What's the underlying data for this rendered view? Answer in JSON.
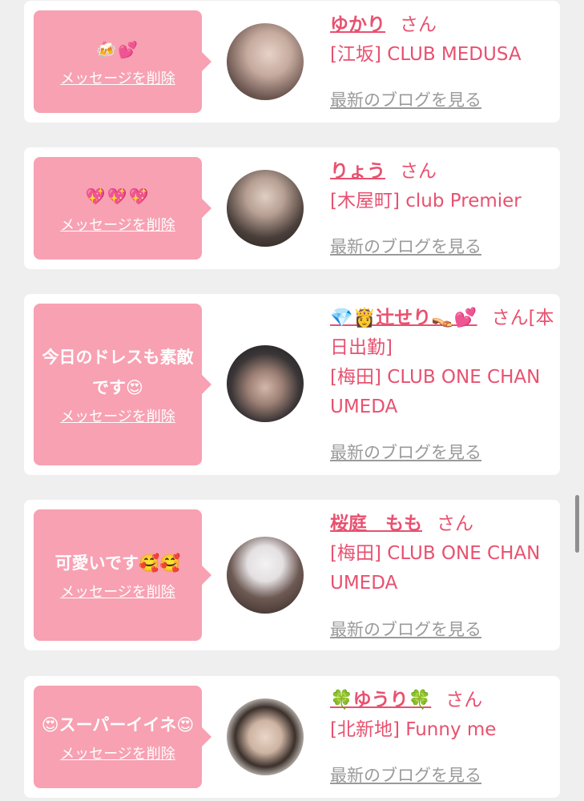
{
  "cards": [
    {
      "message": "🍻💕",
      "message_is_emoji": true,
      "delete_label": "メッセージを削除",
      "name": "ゆかり",
      "honorific": "さん",
      "shop": "[江坂] CLUB MEDUSA",
      "blog_label": "最新のブログを見る",
      "avatar_colors": [
        "#d9c2b8",
        "#5a4742"
      ]
    },
    {
      "message": "💖💖💖",
      "message_is_emoji": true,
      "delete_label": "メッセージを削除",
      "name": "りょう",
      "honorific": "さん",
      "shop": "[木屋町] club Premier",
      "blog_label": "最新のブログを見る",
      "avatar_colors": [
        "#cbb8aa",
        "#2d2724"
      ]
    },
    {
      "message": "今日のドレスも素敵です😍",
      "message_is_emoji": false,
      "delete_label": "メッセージを削除",
      "name": "💎👸辻せり👡💕",
      "honorific": "さん[本日出勤]",
      "shop": "[梅田] CLUB ONE CHAN UMEDA",
      "blog_label": "最新のブログを見る",
      "avatar_colors": [
        "#3a3536",
        "#c7a79b"
      ]
    },
    {
      "message": "可愛いです🥰🥰",
      "message_is_emoji": false,
      "delete_label": "メッセージを削除",
      "name": "桜庭　もも",
      "honorific": "さん",
      "shop": "[梅田] CLUB ONE CHAN UMEDA",
      "blog_label": "最新のブログを見る",
      "avatar_colors": [
        "#e9e6e8",
        "#3f2f2b"
      ]
    },
    {
      "message": "😍スーパーイイネ😍",
      "message_is_emoji": false,
      "delete_label": "メッセージを削除",
      "name": "🍀ゆうり🍀",
      "honorific": "さん",
      "shop": "[北新地] Funny me",
      "blog_label": "最新のブログを見る",
      "avatar_colors": [
        "#f1ece6",
        "#3b302b"
      ]
    }
  ],
  "colors": {
    "accent": "#e8516f",
    "bubble": "#f7a1b2",
    "background": "#efefef",
    "blog_link": "#9a9a9a"
  }
}
